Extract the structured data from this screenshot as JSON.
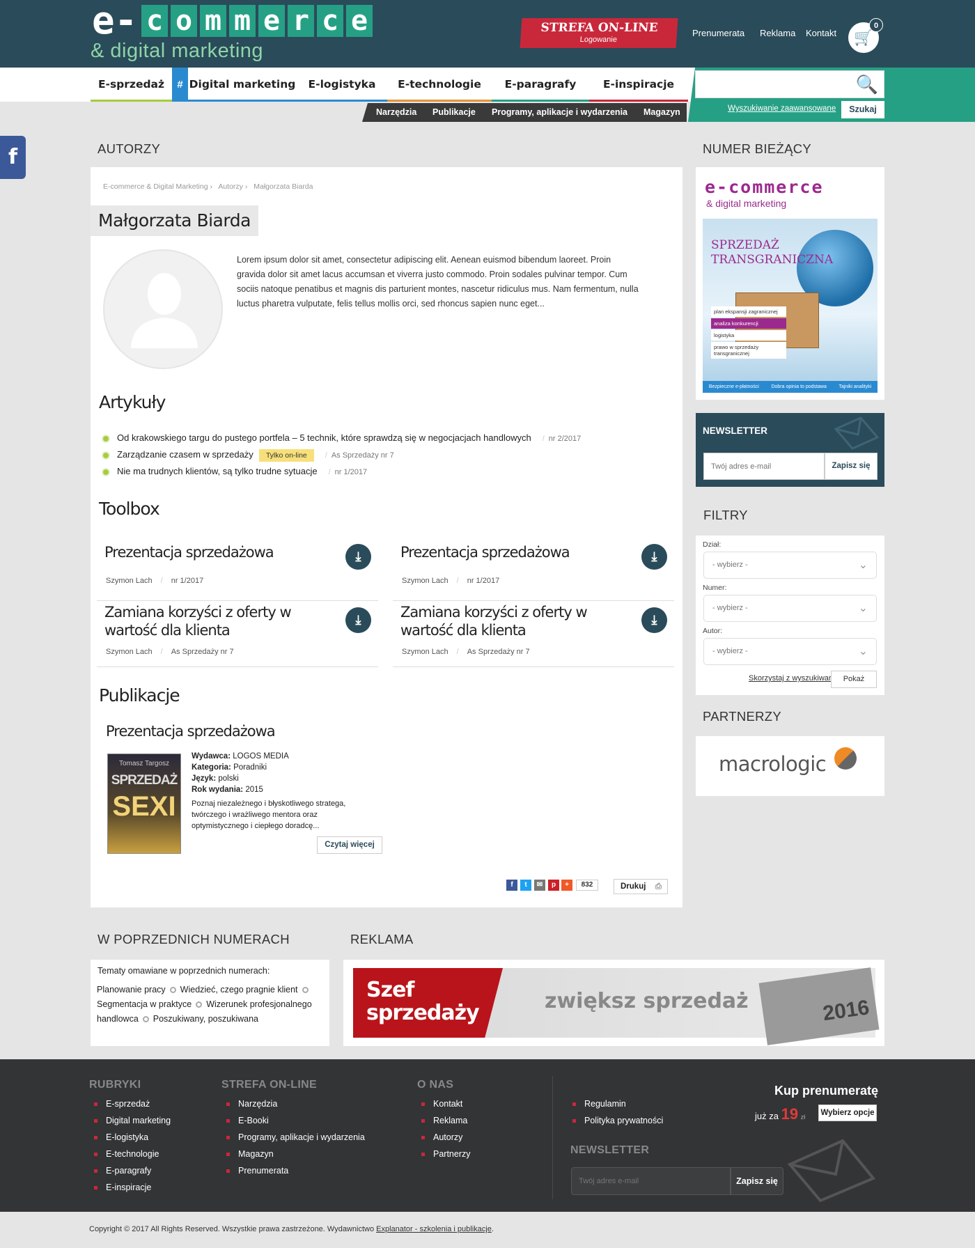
{
  "header": {
    "logo_prefix": "e-",
    "logo_letters": [
      "c",
      "o",
      "m",
      "m",
      "e",
      "r",
      "c",
      "e"
    ],
    "logo_sub": "& digital marketing",
    "strefa_title": "STREFA ON-LINE",
    "strefa_sub": "Logowanie",
    "links": [
      "Prenumerata",
      "Reklama",
      "Kontakt"
    ],
    "cart_count": "0"
  },
  "nav": {
    "items": [
      {
        "label": "E-sprzedaż",
        "color": "#a6cc3f"
      },
      {
        "label": "Digital marketing",
        "color": "#2a8ad0"
      },
      {
        "label": "E-logistyka",
        "color": "#2a8ad0"
      },
      {
        "label": "E-technologie",
        "color": "#e2953a"
      },
      {
        "label": "E-paragrafy",
        "color": "#26a085"
      },
      {
        "label": "E-inspiracje",
        "color": "#c9283b"
      }
    ],
    "hash": "#",
    "sub": [
      "Narzędzia",
      "Publikacje",
      "Programy, aplikacje i wydarzenia",
      "Magazyn"
    ],
    "search_placeholder": "",
    "advanced": "Wyszukiwanie zaawansowane",
    "search_button": "Szukaj"
  },
  "social": {
    "facebook": "f"
  },
  "main": {
    "section_title": "AUTORZY",
    "breadcrumb": [
      "E-commerce & Digital Marketing",
      "›",
      "Autorzy",
      "›",
      "Małgorzata Biarda"
    ],
    "author_name": "Małgorzata Biarda",
    "bio": "Lorem ipsum dolor sit amet, consectetur adipiscing elit. Aenean euismod bibendum laoreet. Proin gravida dolor sit amet lacus accumsan et viverra justo commodo. Proin sodales pulvinar tempor. Cum sociis natoque penatibus et magnis dis parturient montes, nascetur ridiculus mus. Nam fermentum, nulla luctus pharetra vulputate, felis tellus mollis orci, sed rhoncus sapien nunc eget...",
    "articles_heading": "Artykuły",
    "articles": [
      {
        "title": "Od krakowskiego targu do pustego portfela – 5 technik, które sprawdzą się w negocjacjach handlowych",
        "tag": "",
        "meta": "nr 2/2017"
      },
      {
        "title": "Zarządzanie czasem w sprzedaży",
        "tag": "Tylko on-line",
        "meta": "As Sprzedaży nr 7"
      },
      {
        "title": "Nie ma trudnych klientów, są tylko trudne sytuacje",
        "tag": "",
        "meta": "nr 1/2017"
      }
    ],
    "toolbox_heading": "Toolbox",
    "toolbox": [
      {
        "title": "Prezentacja sprzedażowa",
        "author": "Szymon Lach",
        "issue": "nr 1/2017"
      },
      {
        "title": "Prezentacja sprzedażowa",
        "author": "Szymon Lach",
        "issue": "nr 1/2017"
      },
      {
        "title": "Zamiana korzyści z oferty w wartość dla klienta",
        "author": "Szymon Lach",
        "issue": "As Sprzedaży nr 7"
      },
      {
        "title": "Zamiana korzyści z oferty w wartość dla klienta",
        "author": "Szymon Lach",
        "issue": "As Sprzedaży nr 7"
      }
    ],
    "publications_heading": "Publikacje",
    "publication": {
      "title": "Prezentacja sprzedażowa",
      "cover_author": "Tomasz Targosz",
      "cover_title1": "SPRZEDAŻ",
      "cover_title2": "SEXI",
      "publisher_label": "Wydawca:",
      "publisher": "LOGOS MEDIA",
      "category_label": "Kategoria:",
      "category": "Poradniki",
      "language_label": "Język:",
      "language": "polski",
      "year_label": "Rok wydania:",
      "year": "2015",
      "description": "Poznaj niezależnego i błyskotliwego stratega, twórczego i wrażliwego mentora oraz optymistycznego i ciepłego doradcę...",
      "more": "Czytaj więcej"
    },
    "share_count": "832",
    "print": "Drukuj"
  },
  "sidebar": {
    "current_title": "NUMER BIEŻĄCY",
    "cover_logo": "e-commerce",
    "cover_logo_sub": "& digital marketing",
    "cover_headline": "SPRZEDAŻ TRANSGRANICZNA",
    "cover_list": [
      "plan ekspansji zagranicznej",
      "analiza konkurencji",
      "logistyka",
      "prawo w sprzedaży transgranicznej"
    ],
    "cover_footer": [
      "Bezpieczne e-płatności",
      "Dobra opinia to podstawa",
      "Tajniki analityki"
    ],
    "newsletter_title": "NEWSLETTER",
    "newsletter_placeholder": "Twój adres e-mail",
    "newsletter_button": "Zapisz się",
    "filters_title": "FILTRY",
    "filters": [
      {
        "label": "Dział:",
        "value": "- wybierz -"
      },
      {
        "label": "Numer:",
        "value": "- wybierz -"
      },
      {
        "label": "Autor:",
        "value": "- wybierz -"
      }
    ],
    "filters_link": "Skorzystaj z wyszukiwarki",
    "filters_button": "Pokaż",
    "partners_title": "PARTNERZY",
    "partner": "macrologic"
  },
  "lower": {
    "prev_title": "W POPRZEDNICH NUMERACH",
    "prev_intro": "Tematy omawiane w poprzednich numerach:",
    "prev_tags": [
      "Planowanie pracy",
      "Wiedzieć, czego pragnie klient",
      "Segmentacja w praktyce",
      "Wizerunek profesjonalnego handlowca",
      "Poszukiwany, poszukiwana"
    ],
    "ad_title": "REKLAMA",
    "ad_brand": "Szef sprzedaży",
    "ad_slogan": "zwiększ sprzedaż",
    "ad_year": "2016"
  },
  "footer": {
    "col1_title": "RUBRYKI",
    "col1": [
      "E-sprzedaż",
      "Digital marketing",
      "E-logistyka",
      "E-technologie",
      "E-paragrafy",
      "E-inspiracje"
    ],
    "col2_title": "STREFA ON-LINE",
    "col2": [
      "Narzędzia",
      "E-Booki",
      "Programy, aplikacje i wydarzenia",
      "Magazyn",
      "Prenumerata"
    ],
    "col3_title": "O NAS",
    "col3": [
      "Kontakt",
      "Reklama",
      "Autorzy",
      "Partnerzy"
    ],
    "col4": [
      "Regulamin",
      "Polityka prywatności"
    ],
    "buy_title": "Kup prenumeratę",
    "buy_prefix": "już za",
    "buy_price": "19",
    "buy_currency": "zł",
    "buy_button": "Wybierz opcje",
    "newsletter_title": "NEWSLETTER",
    "newsletter_placeholder": "Twój adres e-mail",
    "newsletter_button": "Zapisz się",
    "copyright": "Copyright © 2017 All Rights Reserved. Wszystkie prawa zastrzeżone. Wydawnictwo",
    "publisher_link": "Explanator - szkolenia i publikacje",
    "period": "."
  }
}
